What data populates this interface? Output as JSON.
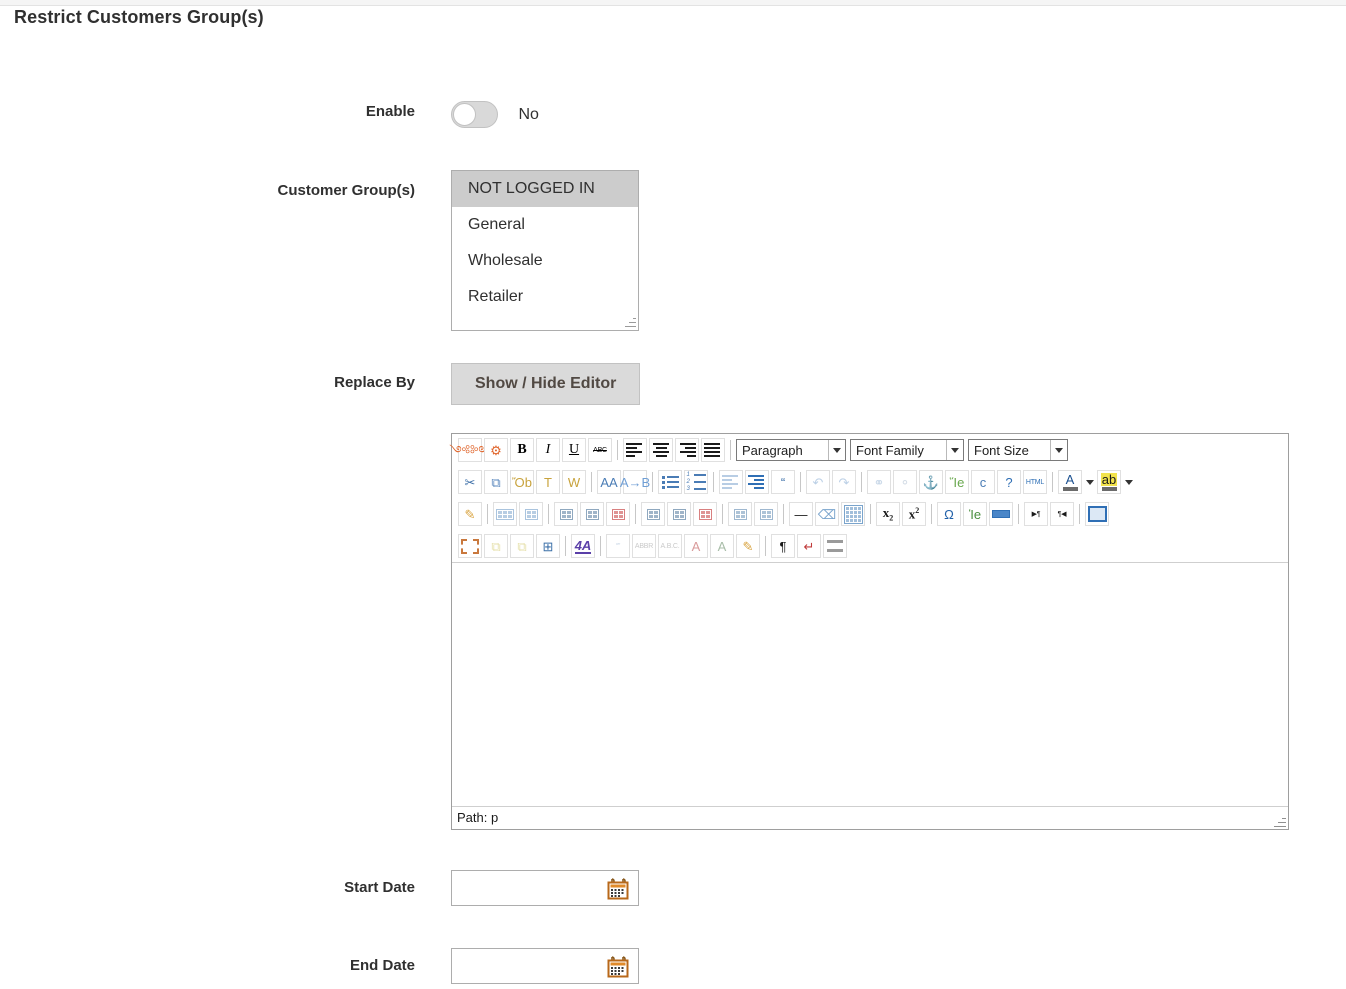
{
  "page": {
    "title": "Restrict Customers Group(s)"
  },
  "fields": {
    "enable": {
      "label": "Enable",
      "toggle_state_text": "No",
      "toggle_on": false,
      "icon": "toggle-switch-icon"
    },
    "customer_groups": {
      "label": "Customer Group(s)",
      "options": [
        {
          "label": "NOT LOGGED IN",
          "selected": true
        },
        {
          "label": "General",
          "selected": false
        },
        {
          "label": "Wholesale",
          "selected": false
        },
        {
          "label": "Retailer",
          "selected": false
        }
      ],
      "resize_handle_icon": "resize-grip-icon"
    },
    "replace_by": {
      "label": "Replace By",
      "button_label": "Show / Hide Editor"
    },
    "start_date": {
      "label": "Start Date",
      "value": "",
      "placeholder": "",
      "calendar_icon": "calendar-icon"
    },
    "end_date": {
      "label": "End Date",
      "value": "",
      "placeholder": "",
      "calendar_icon": "calendar-icon"
    }
  },
  "editor": {
    "content": "",
    "status_text": "Path: p",
    "resize_handle_icon": "resize-grip-icon",
    "selects": [
      {
        "name": "block-format-select",
        "value": "Paragraph",
        "width_class": "cap-w1"
      },
      {
        "name": "font-family-select",
        "value": "Font Family",
        "width_class": "cap-w2"
      },
      {
        "name": "font-size-select",
        "value": "Font Size",
        "width_class": "cap-w3"
      }
    ],
    "toolbar_rows": [
      {
        "name": "toolbar-row-1",
        "items": [
          {
            "type": "btn",
            "icon": "magento-variable-icon",
            "glyph": "༺༻",
            "color": "#e0642a",
            "framed": true
          },
          {
            "type": "btn",
            "icon": "insert-widget-icon",
            "glyph": "⚙",
            "color": "#e0642a",
            "framed": true
          },
          {
            "type": "btn",
            "icon": "bold-icon",
            "glyph": "B",
            "color": "#000000",
            "framed": true,
            "bold": true,
            "serif": true
          },
          {
            "type": "btn",
            "icon": "italic-icon",
            "glyph": "I",
            "color": "#000000",
            "framed": true,
            "italic": true,
            "serif": true
          },
          {
            "type": "btn",
            "icon": "underline-icon",
            "glyph": "U",
            "color": "#000000",
            "framed": true,
            "underline": true,
            "serif": true
          },
          {
            "type": "btn",
            "icon": "strikethrough-icon",
            "glyph": "ABC",
            "color": "#000000",
            "framed": true,
            "strike": true,
            "tiny": true
          },
          {
            "type": "sep"
          },
          {
            "type": "btn",
            "icon": "align-left-icon",
            "glyph": "lines-left",
            "color": "#1a1a1a",
            "framed": true
          },
          {
            "type": "btn",
            "icon": "align-center-icon",
            "glyph": "lines-center",
            "color": "#1a1a1a",
            "framed": true
          },
          {
            "type": "btn",
            "icon": "align-right-icon",
            "glyph": "lines-right",
            "color": "#1a1a1a",
            "framed": true
          },
          {
            "type": "btn",
            "icon": "align-justify-icon",
            "glyph": "lines-justify",
            "color": "#1a1a1a",
            "framed": true
          },
          {
            "type": "sep"
          },
          {
            "type": "select",
            "index": 0
          },
          {
            "type": "select",
            "index": 1
          },
          {
            "type": "select",
            "index": 2
          }
        ]
      },
      {
        "name": "toolbar-row-2",
        "items": [
          {
            "type": "btn",
            "icon": "cut-icon",
            "glyph": "✂",
            "color": "#3d6fa8",
            "framed": true
          },
          {
            "type": "btn",
            "icon": "copy-icon",
            "glyph": "⧉",
            "color": "#5a87bd",
            "framed": true
          },
          {
            "type": "btn",
            "icon": "paste-icon",
            "glyph": "Ὄb",
            "color": "#c8a33d",
            "framed": true
          },
          {
            "type": "btn",
            "icon": "paste-as-text-icon",
            "glyph": "T",
            "color": "#c8a33d",
            "framed": true
          },
          {
            "type": "btn",
            "icon": "paste-from-word-icon",
            "glyph": "W",
            "color": "#c8a33d",
            "framed": true
          },
          {
            "type": "sep"
          },
          {
            "type": "btn",
            "icon": "find-icon",
            "glyph": "AA",
            "color": "#4a7cb5",
            "framed": true
          },
          {
            "type": "btn",
            "icon": "find-and-replace-icon",
            "glyph": "A→B",
            "color": "#6f9ed4",
            "framed": true
          },
          {
            "type": "sep"
          },
          {
            "type": "btn",
            "icon": "bullet-list-icon",
            "glyph": "ul",
            "color": "#4a7cb5",
            "framed": true
          },
          {
            "type": "btn",
            "icon": "numbered-list-icon",
            "glyph": "ol",
            "color": "#4a7cb5",
            "framed": true
          },
          {
            "type": "sep"
          },
          {
            "type": "btn",
            "icon": "outdent-icon",
            "glyph": "outdent",
            "color": "#b8cde4",
            "framed": true
          },
          {
            "type": "btn",
            "icon": "indent-icon",
            "glyph": "indent",
            "color": "#2f6fb5",
            "framed": true
          },
          {
            "type": "btn",
            "icon": "blockquote-icon",
            "glyph": "“",
            "color": "#3b6fa8",
            "framed": true
          },
          {
            "type": "sep"
          },
          {
            "type": "btn",
            "icon": "undo-icon",
            "glyph": "↶",
            "color": "#bcd0e6",
            "framed": true
          },
          {
            "type": "btn",
            "icon": "redo-icon",
            "glyph": "↷",
            "color": "#bcd0e6",
            "framed": true
          },
          {
            "type": "sep"
          },
          {
            "type": "btn",
            "icon": "insert-link-icon",
            "glyph": "⚭",
            "color": "#c9d8e8",
            "framed": true
          },
          {
            "type": "btn",
            "icon": "unlink-icon",
            "glyph": "⚬",
            "color": "#d4dde6",
            "framed": true
          },
          {
            "type": "btn",
            "icon": "anchor-icon",
            "glyph": "⚓",
            "color": "#2c5f94",
            "framed": true
          },
          {
            "type": "btn",
            "icon": "insert-image-icon",
            "glyph": "Ἵe",
            "color": "#6aa84f",
            "framed": true
          },
          {
            "type": "btn",
            "icon": "cleanup-icon",
            "glyph": "὘c",
            "color": "#4a7cb5",
            "framed": true
          },
          {
            "type": "btn",
            "icon": "help-icon",
            "glyph": "?",
            "color": "#2f6fb5",
            "framed": true
          },
          {
            "type": "btn",
            "icon": "edit-html-icon",
            "glyph": "HTML",
            "color": "#2f6fb5",
            "framed": true,
            "tiny": true
          },
          {
            "type": "sep"
          },
          {
            "type": "btn",
            "icon": "text-color-icon",
            "glyph": "A",
            "color": "#1a4f8f",
            "framed": true,
            "swatch": "#6b6b6b"
          },
          {
            "type": "arrow",
            "icon": "text-color-dropdown-arrow-icon"
          },
          {
            "type": "btn",
            "icon": "background-color-icon",
            "glyph": "ab",
            "color": "#1a1a1a",
            "framed": true,
            "swatch": "#6b6b6b",
            "highlight": "#f2e34c"
          },
          {
            "type": "arrow",
            "icon": "background-color-dropdown-arrow-icon"
          }
        ]
      },
      {
        "name": "toolbar-row-3",
        "items": [
          {
            "type": "btn",
            "icon": "insert-edit-table-icon",
            "glyph": "✎",
            "color": "#d9a441",
            "framed": true
          },
          {
            "type": "sep"
          },
          {
            "type": "btn",
            "icon": "table-row-properties-icon",
            "glyph": "trow",
            "color": "#aac4de",
            "framed": true
          },
          {
            "type": "btn",
            "icon": "table-cell-properties-icon",
            "glyph": "tcell",
            "color": "#aac4de",
            "framed": true
          },
          {
            "type": "sep"
          },
          {
            "type": "btn",
            "icon": "insert-row-before-icon",
            "glyph": "rowb",
            "color": "#8fa8bf",
            "framed": true
          },
          {
            "type": "btn",
            "icon": "insert-row-after-icon",
            "glyph": "rowa",
            "color": "#8fa8bf",
            "framed": true
          },
          {
            "type": "btn",
            "icon": "delete-row-icon",
            "glyph": "rowd",
            "color": "#d98080",
            "framed": true
          },
          {
            "type": "sep"
          },
          {
            "type": "btn",
            "icon": "insert-column-before-icon",
            "glyph": "colb",
            "color": "#8fa8bf",
            "framed": true
          },
          {
            "type": "btn",
            "icon": "insert-column-after-icon",
            "glyph": "cola",
            "color": "#8fa8bf",
            "framed": true
          },
          {
            "type": "btn",
            "icon": "delete-column-icon",
            "glyph": "cold",
            "color": "#d98080",
            "framed": true
          },
          {
            "type": "sep"
          },
          {
            "type": "btn",
            "icon": "split-merged-cells-icon",
            "glyph": "split",
            "color": "#9fb8d0",
            "framed": true
          },
          {
            "type": "btn",
            "icon": "merge-cells-icon",
            "glyph": "merge",
            "color": "#9fb8d0",
            "framed": true
          },
          {
            "type": "sep"
          },
          {
            "type": "btn",
            "icon": "horizontal-rule-icon",
            "glyph": "—",
            "color": "#1a1a1a",
            "framed": true
          },
          {
            "type": "btn",
            "icon": "remove-formatting-icon",
            "glyph": "⌫",
            "color": "#7aa4cc",
            "framed": true
          },
          {
            "type": "btn",
            "icon": "toggle-guidelines-icon",
            "glyph": "grid",
            "color": "#7aa4cc",
            "framed": true
          },
          {
            "type": "sep"
          },
          {
            "type": "btn",
            "icon": "subscript-icon",
            "glyph": "x2sub",
            "color": "#1a1a1a",
            "framed": true
          },
          {
            "type": "btn",
            "icon": "superscript-icon",
            "glyph": "x2sup",
            "color": "#1a1a1a",
            "framed": true
          },
          {
            "type": "sep"
          },
          {
            "type": "btn",
            "icon": "special-character-icon",
            "glyph": "Ω",
            "color": "#1f5fa8",
            "framed": true
          },
          {
            "type": "btn",
            "icon": "insert-media-icon",
            "glyph": "Ἱe",
            "color": "#4a8f3f",
            "framed": true
          },
          {
            "type": "btn",
            "icon": "insert-page-break-icon",
            "glyph": "pgbrk",
            "color": "#2f6fb5",
            "framed": true
          },
          {
            "type": "sep"
          },
          {
            "type": "btn",
            "icon": "ltr-direction-icon",
            "glyph": "▶¶",
            "color": "#1a1a1a",
            "framed": true,
            "tiny": true
          },
          {
            "type": "btn",
            "icon": "rtl-direction-icon",
            "glyph": "¶◀",
            "color": "#1a1a1a",
            "framed": true,
            "tiny": true
          },
          {
            "type": "sep"
          },
          {
            "type": "btn",
            "icon": "fullscreen-icon",
            "glyph": "fs",
            "color": "#2f6fb5",
            "framed": true
          }
        ]
      },
      {
        "name": "toolbar-row-4",
        "items": [
          {
            "type": "btn",
            "icon": "select-all-icon",
            "glyph": "selall",
            "color": "#c9783d",
            "framed": true
          },
          {
            "type": "btn",
            "icon": "move-forward-icon",
            "glyph": "⧉",
            "color": "#e5dfa8",
            "framed": true
          },
          {
            "type": "btn",
            "icon": "move-backward-icon",
            "glyph": "⧉",
            "color": "#e5dfa8",
            "framed": true
          },
          {
            "type": "btn",
            "icon": "insert-layer-icon",
            "glyph": "⊞",
            "color": "#3b6fa8",
            "framed": true
          },
          {
            "type": "sep"
          },
          {
            "type": "btn",
            "icon": "styles-icon",
            "glyph": "4A",
            "color": "#5a3fa8",
            "framed": true
          },
          {
            "type": "sep"
          },
          {
            "type": "btn",
            "icon": "citation-icon",
            "glyph": "“”",
            "color": "#c5d3e4",
            "framed": true,
            "tiny": true
          },
          {
            "type": "btn",
            "icon": "abbreviation-icon",
            "glyph": "ABBR",
            "color": "#c9c9c9",
            "framed": true,
            "tiny": true
          },
          {
            "type": "btn",
            "icon": "acronym-icon",
            "glyph": "A.B.C.",
            "color": "#c9c9c9",
            "framed": true,
            "tiny": true
          },
          {
            "type": "btn",
            "icon": "deletion-icon",
            "glyph": "A",
            "color": "#d99b9b",
            "framed": true
          },
          {
            "type": "btn",
            "icon": "insertion-icon",
            "glyph": "A",
            "color": "#a8bda8",
            "framed": true
          },
          {
            "type": "btn",
            "icon": "attributes-icon",
            "glyph": "✎",
            "color": "#d9a441",
            "framed": true
          },
          {
            "type": "sep"
          },
          {
            "type": "btn",
            "icon": "show-blocks-icon",
            "glyph": "¶",
            "color": "#1a1a1a",
            "framed": true
          },
          {
            "type": "btn",
            "icon": "nonbreaking-icon",
            "glyph": "↵",
            "color": "#c03b3b",
            "framed": true
          },
          {
            "type": "btn",
            "icon": "insert-template-icon",
            "glyph": "tmpl",
            "color": "#9a9a9a",
            "framed": true
          }
        ]
      }
    ]
  }
}
